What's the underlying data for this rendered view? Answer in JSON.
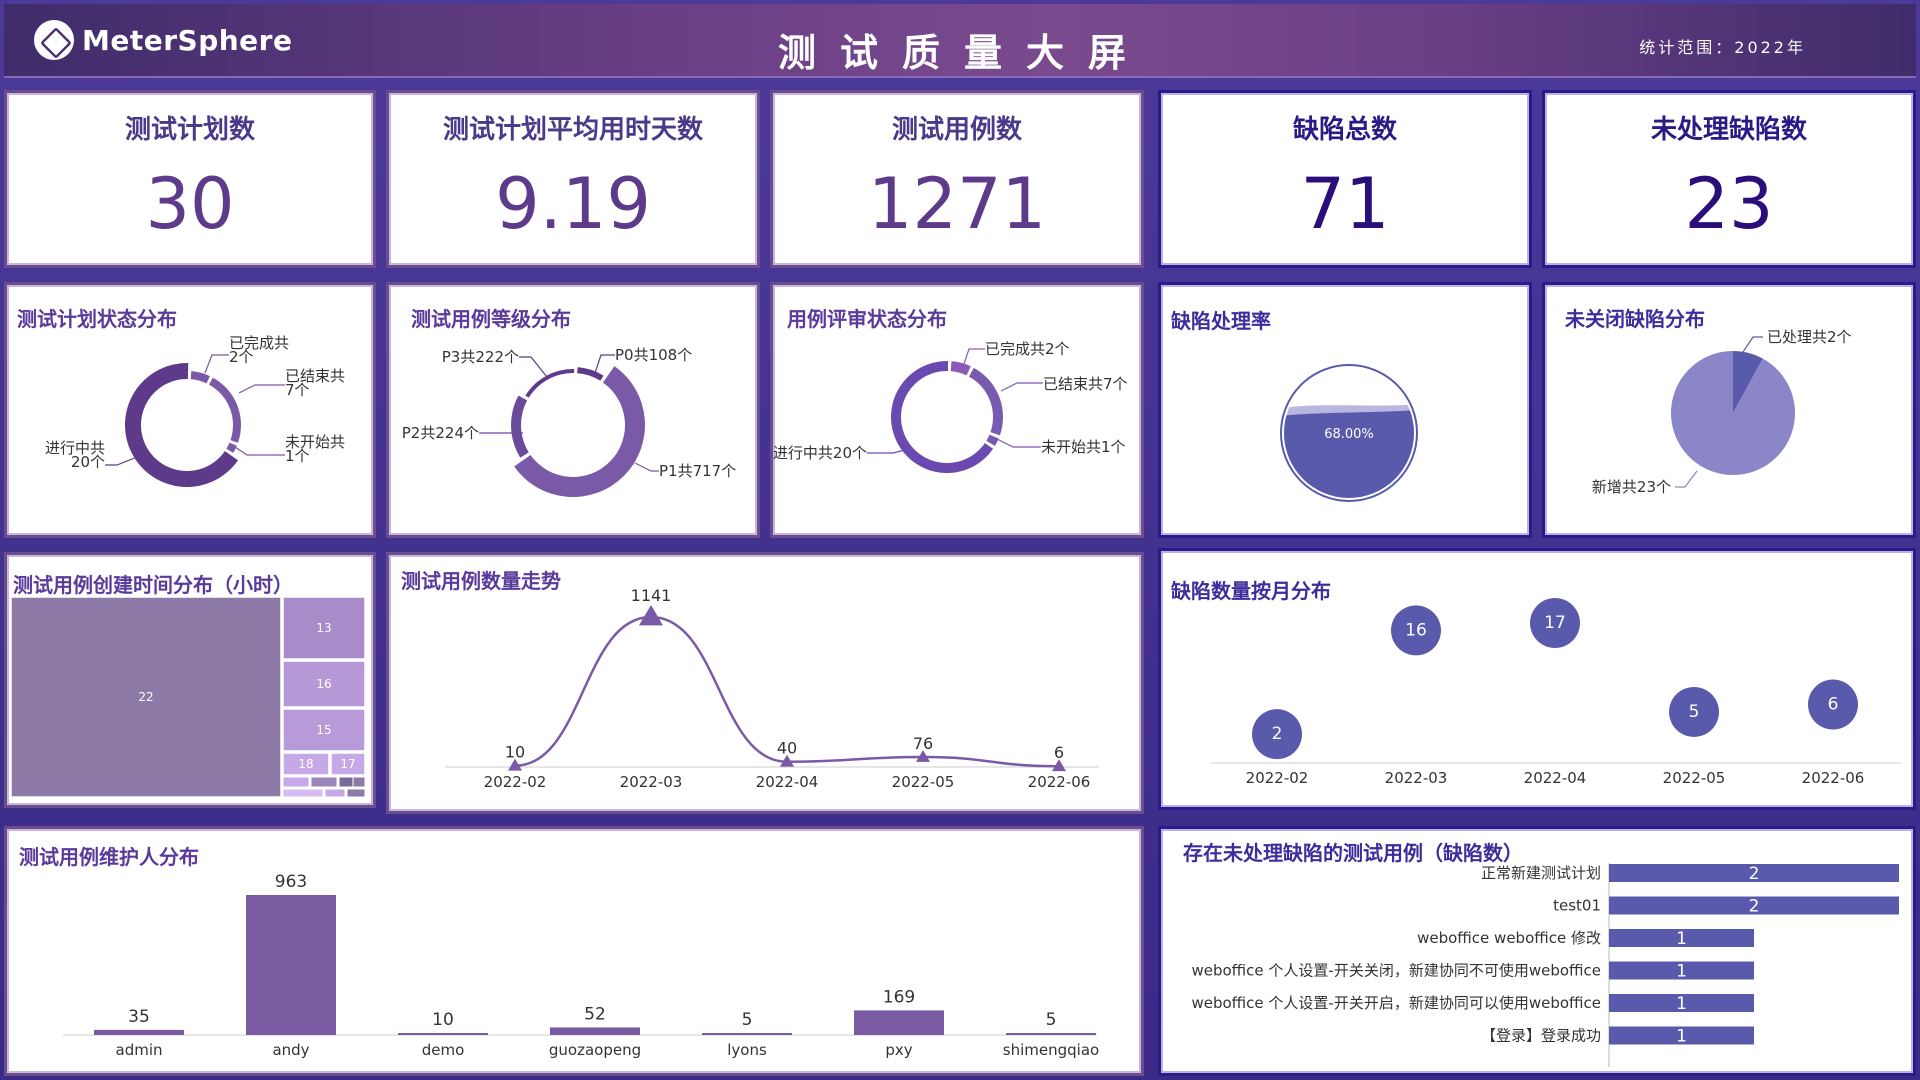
{
  "header": {
    "logo_text": "MeterSphere",
    "title": "测试质量大屏",
    "scope": "统计范围：2022年"
  },
  "kpis": [
    {
      "label": "测试计划数",
      "value": "30"
    },
    {
      "label": "测试计划平均用时天数",
      "value": "9.19"
    },
    {
      "label": "测试用例数",
      "value": "1271"
    },
    {
      "label": "缺陷总数",
      "value": "71"
    },
    {
      "label": "未处理缺陷数",
      "value": "23"
    }
  ],
  "panels": {
    "plan_status": {
      "title": "测试计划状态分布"
    },
    "case_level": {
      "title": "测试用例等级分布"
    },
    "review_status": {
      "title": "用例评审状态分布"
    },
    "defect_rate": {
      "title": "缺陷处理率"
    },
    "unclosed_defects": {
      "title": "未关闭缺陷分布"
    },
    "case_create_time": {
      "title": "测试用例创建时间分布（小时）"
    },
    "case_trend": {
      "title": "测试用例数量走势"
    },
    "defect_month": {
      "title": "缺陷数量按月分布"
    },
    "maintainer": {
      "title": "测试用例维护人分布"
    },
    "unprocessed_cases": {
      "title": "存在未处理缺陷的测试用例（缺陷数）"
    }
  },
  "colors": {
    "purple": "#5e3a8a",
    "purple_mid": "#7a5aa6",
    "blue_dark": "#2b1a8a",
    "indigo": "#5a5aac",
    "indigo_light": "#8a86c8"
  },
  "chart_data": [
    {
      "id": "plan_status",
      "type": "pie",
      "donut": true,
      "slices": [
        {
          "label": "已完成共2个",
          "value": 2
        },
        {
          "label": "已结束共7个",
          "value": 7
        },
        {
          "label": "未开始共1个",
          "value": 1
        },
        {
          "label": "进行中共20个",
          "value": 20
        }
      ]
    },
    {
      "id": "case_level",
      "type": "pie",
      "donut": true,
      "slices": [
        {
          "label": "P0共108个",
          "value": 108
        },
        {
          "label": "P1共717个",
          "value": 717
        },
        {
          "label": "P2共224个",
          "value": 224
        },
        {
          "label": "P3共222个",
          "value": 222
        }
      ]
    },
    {
      "id": "review_status",
      "type": "pie",
      "donut": true,
      "slices": [
        {
          "label": "已完成共2个",
          "value": 2
        },
        {
          "label": "已结束共7个",
          "value": 7
        },
        {
          "label": "未开始共1个",
          "value": 1
        },
        {
          "label": "进行中共20个",
          "value": 20
        }
      ]
    },
    {
      "id": "defect_rate",
      "type": "pie",
      "value_label": "68.00%",
      "value": 68
    },
    {
      "id": "unclosed_defects",
      "type": "pie",
      "slices": [
        {
          "label": "已处理共2个",
          "value": 2
        },
        {
          "label": "新增共23个",
          "value": 23
        }
      ]
    },
    {
      "id": "case_create_time",
      "type": "heatmap",
      "values": [
        22,
        13,
        16,
        15,
        18,
        17
      ]
    },
    {
      "id": "case_trend",
      "type": "line",
      "categories": [
        "2022-02",
        "2022-03",
        "2022-04",
        "2022-05",
        "2022-06"
      ],
      "values": [
        10,
        1141,
        40,
        76,
        6
      ]
    },
    {
      "id": "defect_month",
      "type": "scatter",
      "categories": [
        "2022-02",
        "2022-03",
        "2022-04",
        "2022-05",
        "2022-06"
      ],
      "values": [
        2,
        16,
        17,
        5,
        6
      ]
    },
    {
      "id": "maintainer",
      "type": "bar",
      "categories": [
        "admin",
        "andy",
        "demo",
        "guozaopeng",
        "lyons",
        "pxy",
        "shimengqiao"
      ],
      "values": [
        35,
        963,
        10,
        52,
        5,
        169,
        5
      ]
    },
    {
      "id": "unprocessed_cases",
      "type": "bar",
      "orientation": "horizontal",
      "categories": [
        "正常新建测试计划",
        "test01",
        "weboffice weboffice 修改",
        "weboffice 个人设置-开关关闭，新建协同不可使用weboffice",
        "weboffice 个人设置-开关开启，新建协同可以使用weboffice",
        "【登录】登录成功"
      ],
      "values": [
        2,
        2,
        1,
        1,
        1,
        1
      ]
    }
  ]
}
